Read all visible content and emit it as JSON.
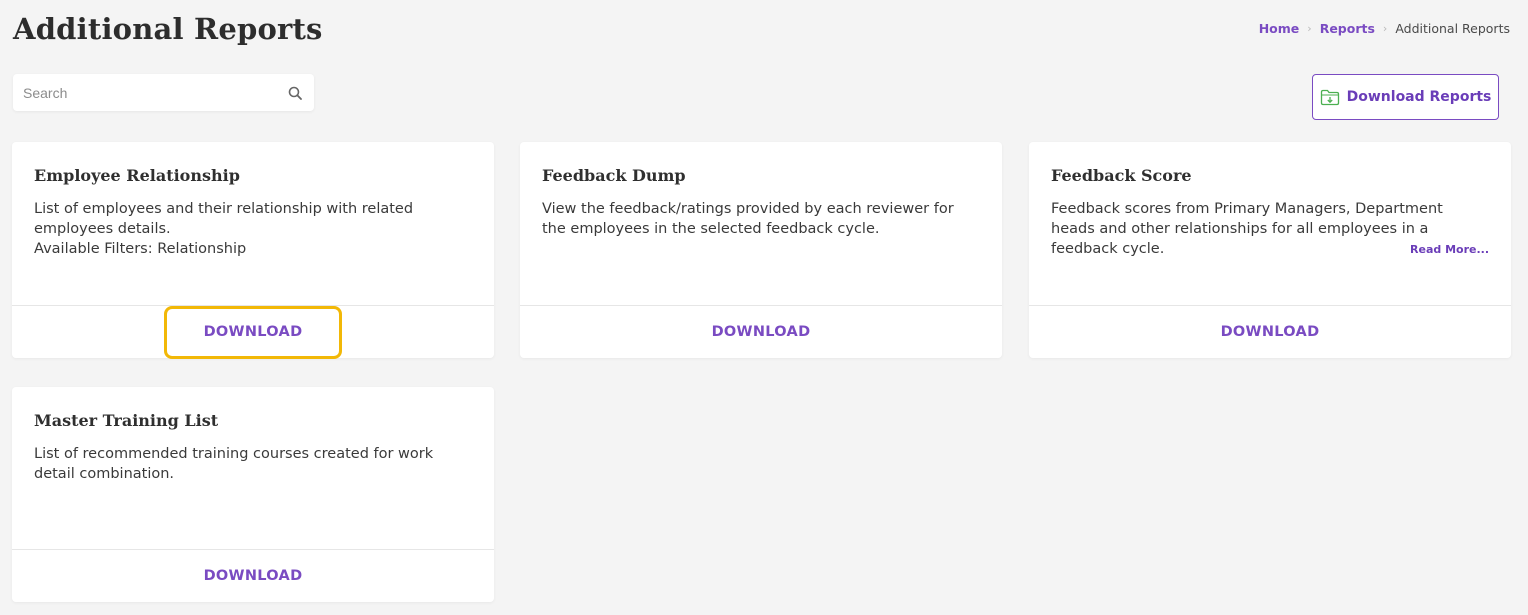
{
  "page": {
    "title": "Additional Reports"
  },
  "breadcrumb": {
    "items": [
      "Home",
      "Reports"
    ],
    "current": "Additional Reports",
    "separator": "›"
  },
  "search": {
    "placeholder": "Search",
    "value": ""
  },
  "toolbar": {
    "download_reports_label": "Download Reports"
  },
  "reports": [
    {
      "title": "Employee Relationship",
      "description": "List of employees and their relationship with related employees details.",
      "filters": "Available Filters: Relationship",
      "action": "DOWNLOAD"
    },
    {
      "title": "Feedback Dump",
      "description": "View the feedback/ratings provided by each reviewer for the employees in the selected feedback cycle.",
      "action": "DOWNLOAD"
    },
    {
      "title": "Feedback Score",
      "description": "Feedback scores from Primary Managers, Department heads and other relationships for all employees in a feedback cycle.",
      "read_more": "Read More...",
      "action": "DOWNLOAD"
    },
    {
      "title": "Master Training List",
      "description": "List of recommended training courses created for work detail combination.",
      "action": "DOWNLOAD"
    }
  ],
  "colors": {
    "accent": "#7a4bc2",
    "highlight": "#f2b807",
    "background": "#f4f4f4",
    "folder_icon": "#4caf50"
  },
  "icons": {
    "search": "search-icon",
    "download_reports": "folder-download-icon"
  }
}
